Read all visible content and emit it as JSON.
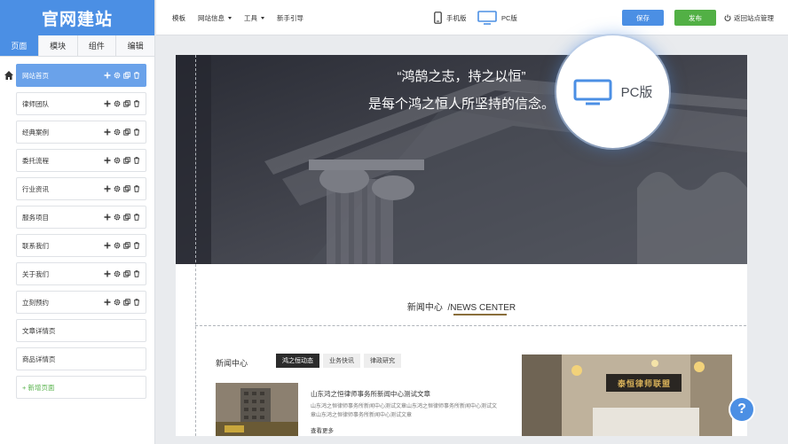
{
  "app": {
    "logo": "官网建站"
  },
  "left_tabs": [
    {
      "label": "页面",
      "active": true
    },
    {
      "label": "模块",
      "active": false
    },
    {
      "label": "组件",
      "active": false
    },
    {
      "label": "编辑",
      "active": false
    }
  ],
  "pages": [
    {
      "label": "网站首页",
      "active": true,
      "tools": true
    },
    {
      "label": "律师团队",
      "active": false,
      "tools": true
    },
    {
      "label": "经典案例",
      "active": false,
      "tools": true
    },
    {
      "label": "委托流程",
      "active": false,
      "tools": true
    },
    {
      "label": "行业资讯",
      "active": false,
      "tools": true
    },
    {
      "label": "服务项目",
      "active": false,
      "tools": true
    },
    {
      "label": "联系我们",
      "active": false,
      "tools": true
    },
    {
      "label": "关于我们",
      "active": false,
      "tools": true
    },
    {
      "label": "立刻预约",
      "active": false,
      "tools": true
    },
    {
      "label": "文章详情页",
      "active": false,
      "tools": false
    },
    {
      "label": "商品详情页",
      "active": false,
      "tools": false
    }
  ],
  "add_page": "+ 新增页面",
  "toolbar": {
    "menu": [
      "模板",
      "网站信息",
      "工具",
      "新手引导"
    ],
    "mobile_label": "手机版",
    "pc_label": "PC版",
    "save_label": "保存",
    "publish_label": "发布",
    "back_label": "返回站点管理"
  },
  "hero": {
    "line1": "“鸿鹄之志，持之以恒”",
    "line2": "是每个鸿之恒人所坚持的信念。"
  },
  "news_center": {
    "cn": "新闻中心",
    "en": "/NEWS CENTER"
  },
  "news_section": {
    "title": "新闻中心",
    "tabs": [
      "鸿之恒动态",
      "业务快讯",
      "律政研究"
    ],
    "article_title": "山东鸿之恒律师事务所新闻中心测试文章",
    "article_desc": "山东鸿之恒律师事务所新闻中心测试文章山东鸿之恒律师事务所新闻中心测试文章山东鸿之恒律师事务所新闻中心测试文章",
    "more": "查看更多",
    "photo_sign": "泰恒律师联盟"
  },
  "magnifier_label": "PC版",
  "help": "?",
  "colors": {
    "accent": "#4b8fe4",
    "publish": "#52b045"
  }
}
